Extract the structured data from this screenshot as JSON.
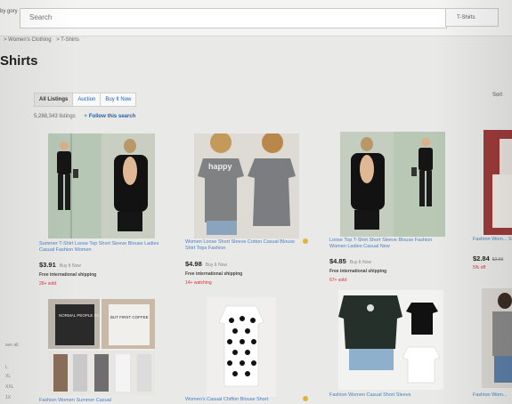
{
  "header": {
    "shop_by": "by\ngory",
    "search_placeholder": "Search",
    "category": "T-Shirts"
  },
  "breadcrumb": [
    "> Women's Clothing",
    "> T-Shirts"
  ],
  "page_title": "Shirts",
  "tabs": [
    {
      "label": "All Listings",
      "active": true
    },
    {
      "label": "Auction",
      "active": false
    },
    {
      "label": "Buy It Now",
      "active": false
    }
  ],
  "sort_label": "Sort",
  "results": {
    "count": "5,288,343 listings",
    "follow": "Follow this search"
  },
  "left_margin": [
    "see all",
    "L",
    "XL",
    "XXL",
    "1X"
  ],
  "listings": [
    {
      "title": "Summer T-Shirt Loose Top Short Sleeve Blouse Ladies Casual Fashion Women",
      "price": "$3.91",
      "buy": "Buy It Now",
      "shipping": "Free international shipping",
      "status": "26+ sold"
    },
    {
      "title": "Women Loose Short Sleeve Cotton Casual Blouse Shirt Tops Fashion",
      "price": "$4.98",
      "buy": "Buy It Now",
      "shipping": "Free international shipping",
      "status": "14+ watching",
      "shirt_text": "happy"
    },
    {
      "title": "Loose Top T-Shirt Short Sleeve Blouse Fashion Women Ladies Casual New",
      "price": "$4.85",
      "buy": "Buy It Now",
      "shipping": "Free international shipping",
      "status": "67+ sold"
    },
    {
      "title": "Fashion Wom... Sleeve Cotto...",
      "price": "$2.84",
      "old_price": "$2.99",
      "status": "5% off"
    },
    {
      "title": "Fashion Women Summer Casual",
      "shirt_text_1": "NORMAL PEOPLE SCARE ME",
      "shirt_text_2": "BUT FIRST COFFEE"
    },
    {
      "title": "Women's Casual Chiffon Blouse Short"
    },
    {
      "title": "Fashion Women Casual Short Sleeve"
    },
    {
      "title": "Fashion Wom..."
    }
  ],
  "colors": {
    "link": "#4a7fc0",
    "accent_blue": "#1a5fb4",
    "sold_red": "#cc3333",
    "watch_yellow": "#e0b53b"
  }
}
